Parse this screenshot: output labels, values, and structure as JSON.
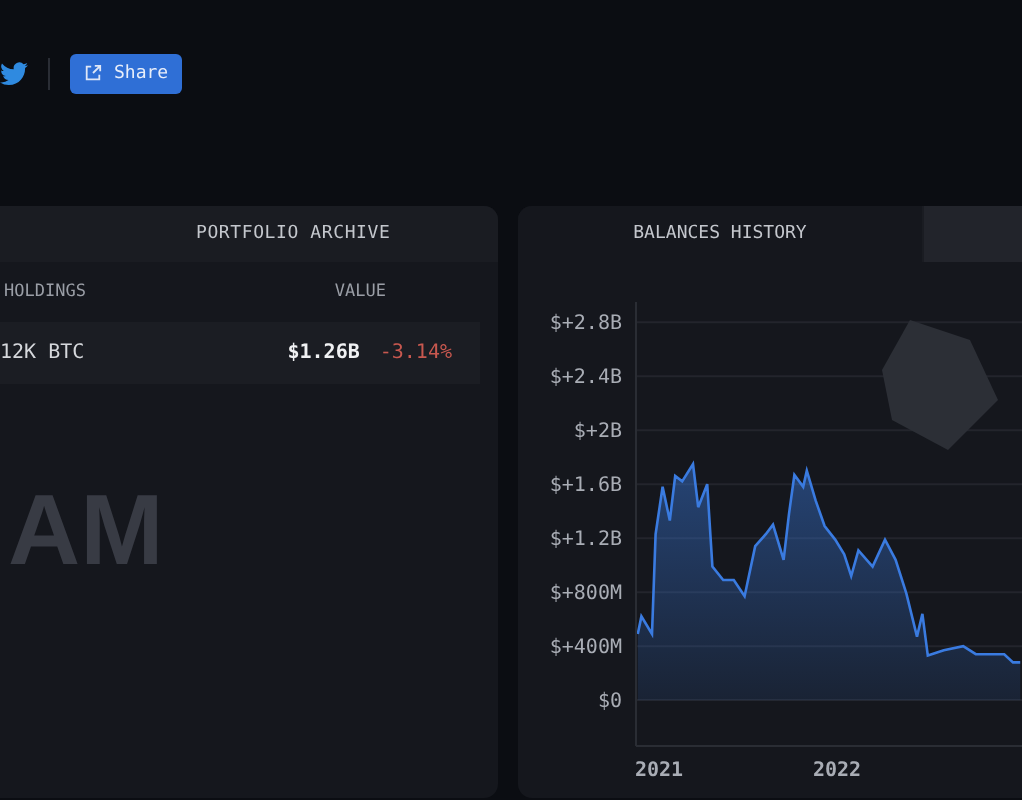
{
  "header": {
    "share_button": "Share"
  },
  "portfolio": {
    "title": "PORTFOLIO ARCHIVE",
    "columns": [
      "HOLDINGS",
      "VALUE"
    ],
    "rows": [
      {
        "holding": "12K BTC",
        "value": "$1.26B",
        "change": "-3.14%"
      }
    ],
    "watermark": "AM"
  },
  "balances": {
    "tabs": [
      {
        "label": "BALANCES HISTORY",
        "selected": true
      },
      {
        "selected": false
      }
    ],
    "chart_data": {
      "type": "area",
      "grid": true,
      "xlim": [
        2020.87,
        2023.13
      ],
      "ylim": [
        -340000000,
        2950000000
      ],
      "xticks": [
        2021,
        2022
      ],
      "yticks": [
        {
          "value": 0,
          "label": "$0"
        },
        {
          "value": 400000000,
          "label": "$+400M"
        },
        {
          "value": 800000000,
          "label": "$+800M"
        },
        {
          "value": 1200000000,
          "label": "$+1.2B"
        },
        {
          "value": 1600000000,
          "label": "$+1.6B"
        },
        {
          "value": 2000000000,
          "label": "$+2B"
        },
        {
          "value": 2400000000,
          "label": "$+2.4B"
        },
        {
          "value": 2800000000,
          "label": "$+2.8B"
        }
      ],
      "x": [
        2020.88,
        2020.9,
        2020.96,
        2020.98,
        2021.02,
        2021.06,
        2021.09,
        2021.13,
        2021.19,
        2021.22,
        2021.27,
        2021.3,
        2021.36,
        2021.42,
        2021.48,
        2021.54,
        2021.6,
        2021.64,
        2021.7,
        2021.73,
        2021.76,
        2021.81,
        2021.83,
        2021.88,
        2021.93,
        2021.99,
        2022.04,
        2022.08,
        2022.12,
        2022.2,
        2022.27,
        2022.33,
        2022.39,
        2022.45,
        2022.48,
        2022.51,
        2022.6,
        2022.71,
        2022.78,
        2022.94,
        2022.99,
        2023.03
      ],
      "series": [
        {
          "color": "#3a7be0",
          "values": [
            490000000,
            620000000,
            490000000,
            1230000000,
            1580000000,
            1330000000,
            1660000000,
            1620000000,
            1750000000,
            1430000000,
            1600000000,
            990000000,
            890000000,
            890000000,
            770000000,
            1140000000,
            1230000000,
            1300000000,
            1040000000,
            1380000000,
            1670000000,
            1580000000,
            1700000000,
            1480000000,
            1290000000,
            1190000000,
            1080000000,
            920000000,
            1110000000,
            990000000,
            1190000000,
            1040000000,
            790000000,
            470000000,
            640000000,
            330000000,
            370000000,
            400000000,
            340000000,
            340000000,
            280000000,
            280000000
          ]
        }
      ]
    }
  }
}
